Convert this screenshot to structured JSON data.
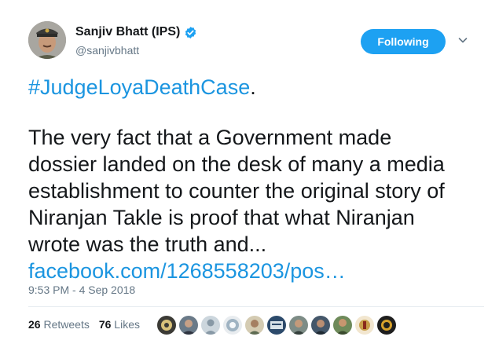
{
  "author": {
    "display_name": "Sanjiv Bhatt (IPS)",
    "handle": "@sanjivbhatt",
    "verified_icon": "verified-badge-icon"
  },
  "follow_button": {
    "label": "Following"
  },
  "menu_caret": {
    "icon": "chevron-down-icon"
  },
  "tweet": {
    "hashtag": "#JudgeLoyaDeathCase",
    "hashtag_suffix": ".",
    "lines": [
      "The very fact that a Government made",
      "dossier landed on the desk of many a media",
      "establishment to counter the original story of",
      "Niranjan Takle is proof that what Niranjan",
      "wrote was the truth and..."
    ],
    "link": "facebook.com/1268558203/pos…"
  },
  "timestamp": "9:53 PM - 4 Sep 2018",
  "stats": {
    "retweets_count": "26",
    "retweets_label": "Retweets",
    "likes_count": "76",
    "likes_label": "Likes"
  },
  "colors": {
    "accent": "#1da1f2",
    "link": "#1b95e0",
    "secondary_text": "#657786",
    "primary_text": "#14171a"
  }
}
